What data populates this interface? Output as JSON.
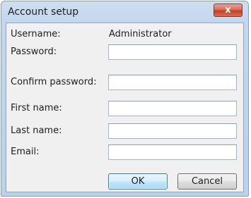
{
  "window": {
    "title": "Account setup",
    "close_label": "x"
  },
  "form": {
    "username_label": "Username:",
    "username_value": "Administrator",
    "password_label": "Password:",
    "password_value": "",
    "confirm_password_label": "Confirm password:",
    "confirm_password_value": "",
    "first_name_label": "First name:",
    "first_name_value": "",
    "last_name_label": "Last name:",
    "last_name_value": "",
    "email_label": "Email:",
    "email_value": ""
  },
  "buttons": {
    "ok_label": "OK",
    "cancel_label": "Cancel"
  },
  "colors": {
    "title_bar": "#c3d6ee",
    "close_button": "#c94a33",
    "ok_border": "#3c7fb1"
  }
}
